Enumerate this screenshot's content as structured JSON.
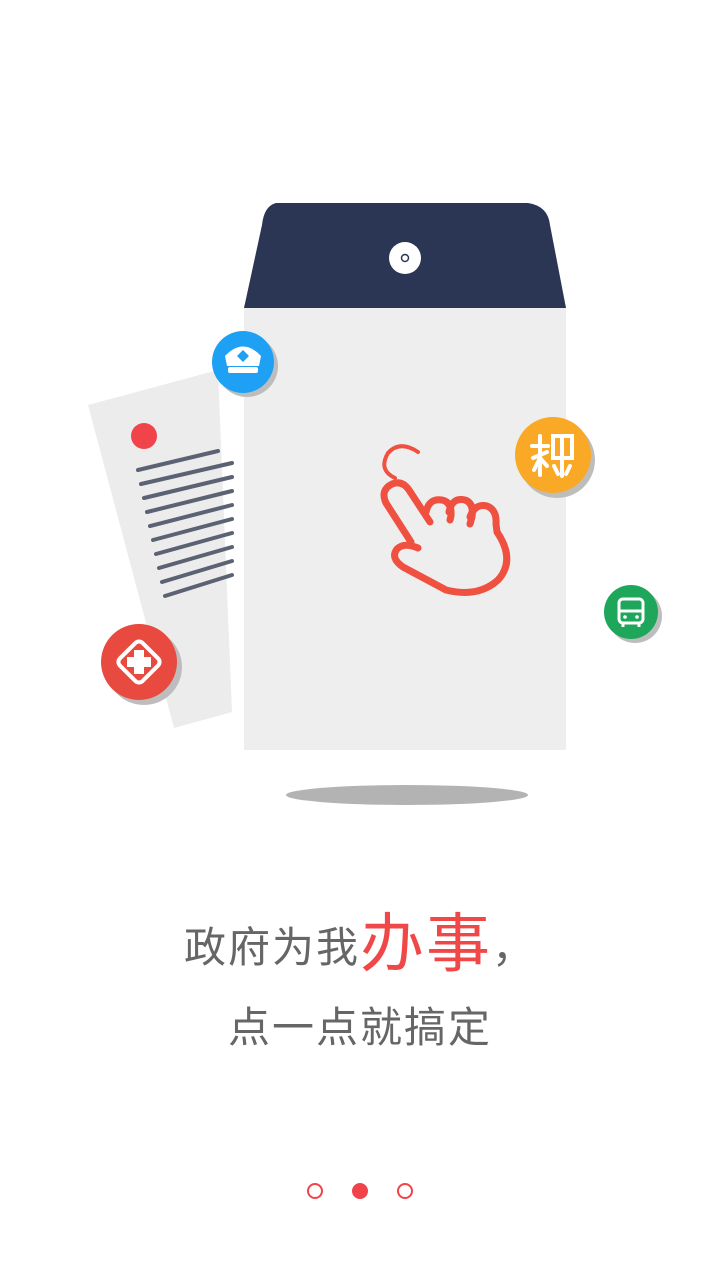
{
  "headline": {
    "part1": "政府为我",
    "accent": "办事",
    "comma": "，",
    "line2": "点一点就搞定"
  },
  "pager": {
    "count": 3,
    "active_index": 1
  },
  "colors": {
    "accent": "#f04848",
    "text": "#666666",
    "envelope_flap": "#2a3653",
    "envelope_body": "#eeeeee",
    "police_badge": "#1ea0f5",
    "tax_badge": "#f9a925",
    "medical_badge": "#e84a3f",
    "bus_badge": "#1ea65b"
  },
  "icons": {
    "police": "police-cap-icon",
    "tax": "tax-icon",
    "medical": "medical-cross-icon",
    "bus": "bus-icon",
    "hand": "pointing-hand-icon"
  }
}
